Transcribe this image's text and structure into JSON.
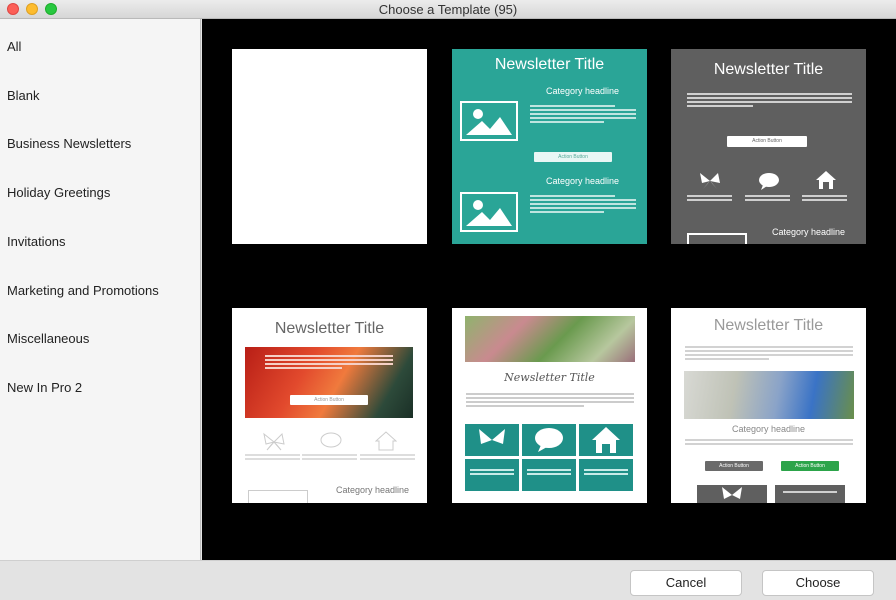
{
  "window": {
    "title": "Choose a Template (95)"
  },
  "sidebar": {
    "items": [
      {
        "label": "All"
      },
      {
        "label": "Blank"
      },
      {
        "label": "Business Newsletters"
      },
      {
        "label": "Holiday Greetings"
      },
      {
        "label": "Invitations"
      },
      {
        "label": "Marketing and Promotions"
      },
      {
        "label": "Miscellaneous"
      },
      {
        "label": "New In Pro 2"
      }
    ]
  },
  "templates": [
    {
      "name": "blank"
    },
    {
      "name": "teal-newsletter",
      "title": "Newsletter Title",
      "headline1": "Category headline",
      "headline2": "Category headline",
      "button": "Action Button",
      "accent": "#2aa597"
    },
    {
      "name": "gray-newsletter",
      "title": "Newsletter Title",
      "headline": "Category headline",
      "button": "Action Button",
      "accent": "#5f5f5f"
    },
    {
      "name": "red-flower-newsletter",
      "title": "Newsletter Title",
      "headline": "Category headline",
      "button": "Action Button",
      "accent": "#e0473a"
    },
    {
      "name": "leaf-newsletter",
      "title": "Newsletter Title",
      "accent": "#1f9088"
    },
    {
      "name": "blossom-newsletter",
      "title": "Newsletter Title",
      "headline": "Category headline",
      "button1": "Action Button",
      "button2": "Action Button",
      "accent": "#2ca44a"
    }
  ],
  "footer": {
    "cancel_label": "Cancel",
    "choose_label": "Choose"
  }
}
